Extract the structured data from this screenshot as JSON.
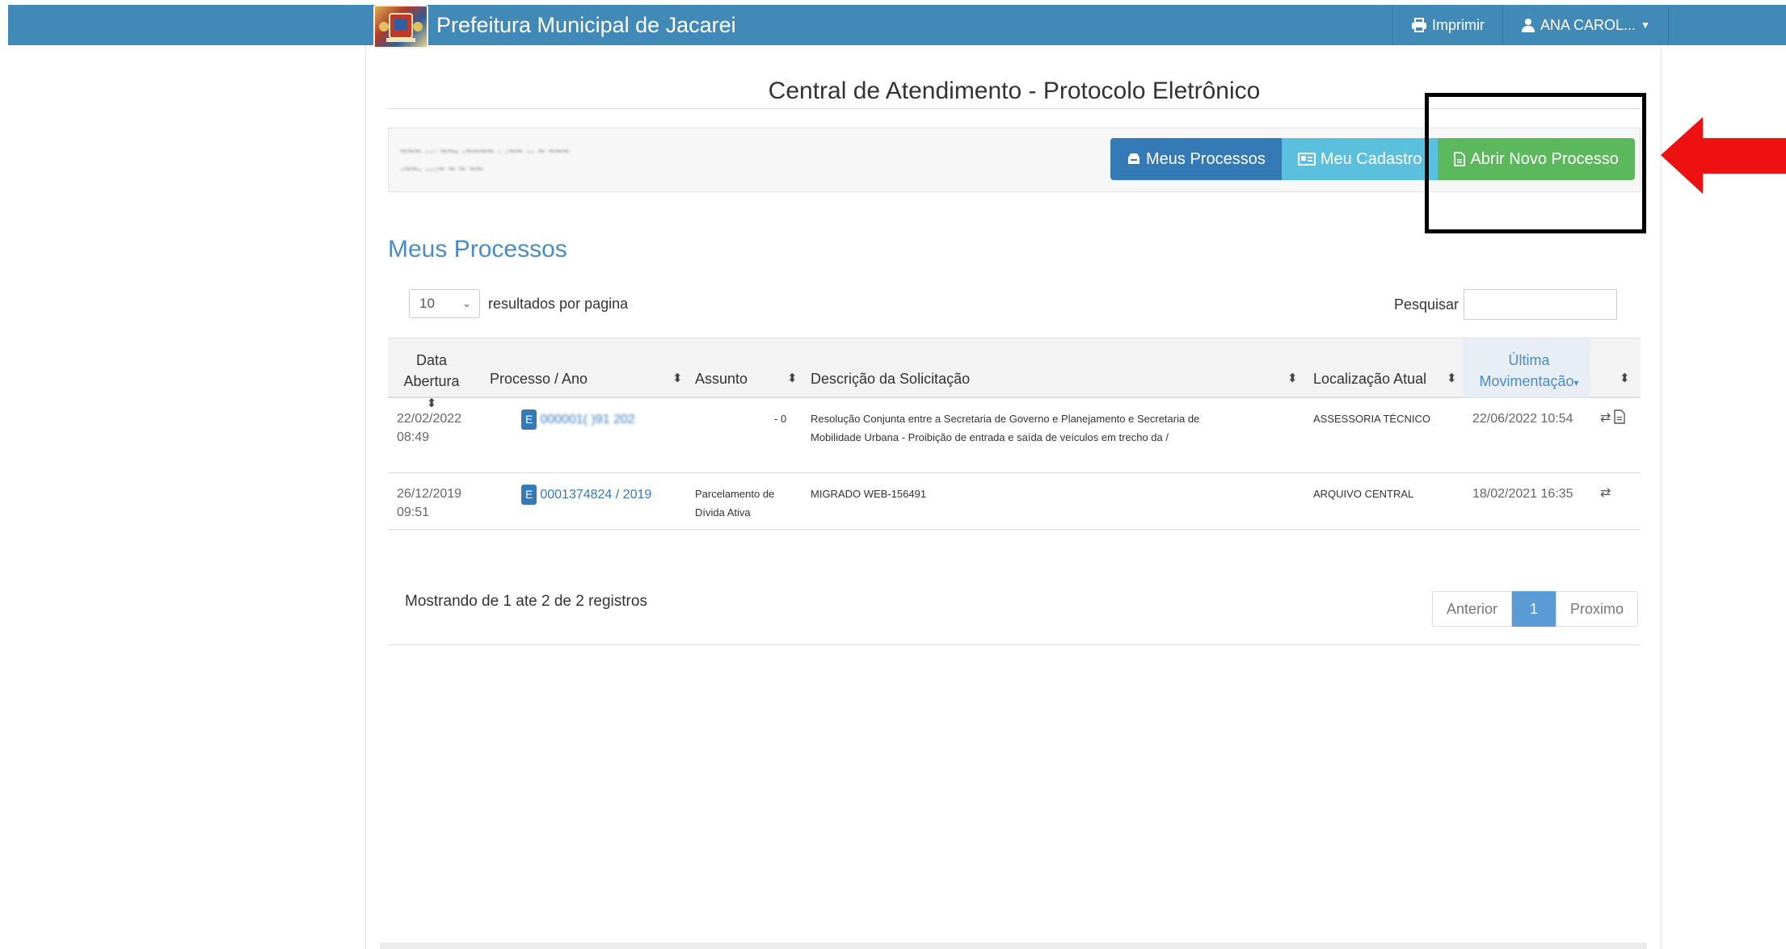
{
  "navbar": {
    "title": "Prefeitura Municipal de Jacarei",
    "print_label": "Imprimir",
    "user_label": "ANA CAROL...",
    "color": "#4189b7"
  },
  "page": {
    "title": "Central de Atendimento - Protocolo Eletrônico",
    "section_title": "Meus Processos"
  },
  "actions": {
    "meus_processos": "Meus Processos",
    "meu_cadastro": "Meu Cadastro",
    "abrir_novo_processo": "Abrir Novo Processo"
  },
  "list_controls": {
    "page_length": "10",
    "length_label": "resultados por pagina",
    "search_label": "Pesquisar"
  },
  "table": {
    "headers": {
      "data_abertura_1": "Data",
      "data_abertura_2": "Abertura",
      "processo": "Processo / Ano",
      "assunto": "Assunto",
      "descricao": "Descrição da Solicitação",
      "localizacao": "Localização Atual",
      "ultima_1": "Última",
      "ultima_2": "Movimentação"
    },
    "rows": [
      {
        "date": "22/02/2022",
        "time": "08:49",
        "badge": "E",
        "processo": "000001( )91  202",
        "assunto": "- 0",
        "descricao_1": "Resolução Conjunta entre a Secretaria de Governo e Planejamento e Secretaria de",
        "descricao_2": "Mobilidade Urbana - Proibição de entrada e saída de veículos em trecho da /",
        "localizacao": "ASSESSORIA TÉCNICO",
        "ultima": "22/06/2022 10:54"
      },
      {
        "date": "26/12/2019",
        "time": "09:51",
        "badge": "E",
        "processo": "0001374824 / 2019",
        "assunto_1": "Parcelamento de",
        "assunto_2": "Dívida Ativa",
        "descricao_1": "MIGRADO WEB-156491",
        "localizacao": "ARQUIVO CENTRAL",
        "ultima": "18/02/2021 16:35"
      }
    ]
  },
  "footer": {
    "showing": "Mostrando de 1 ate 2 de 2 registros",
    "prev": "Anterior",
    "current_page": "1",
    "next": "Proximo"
  }
}
